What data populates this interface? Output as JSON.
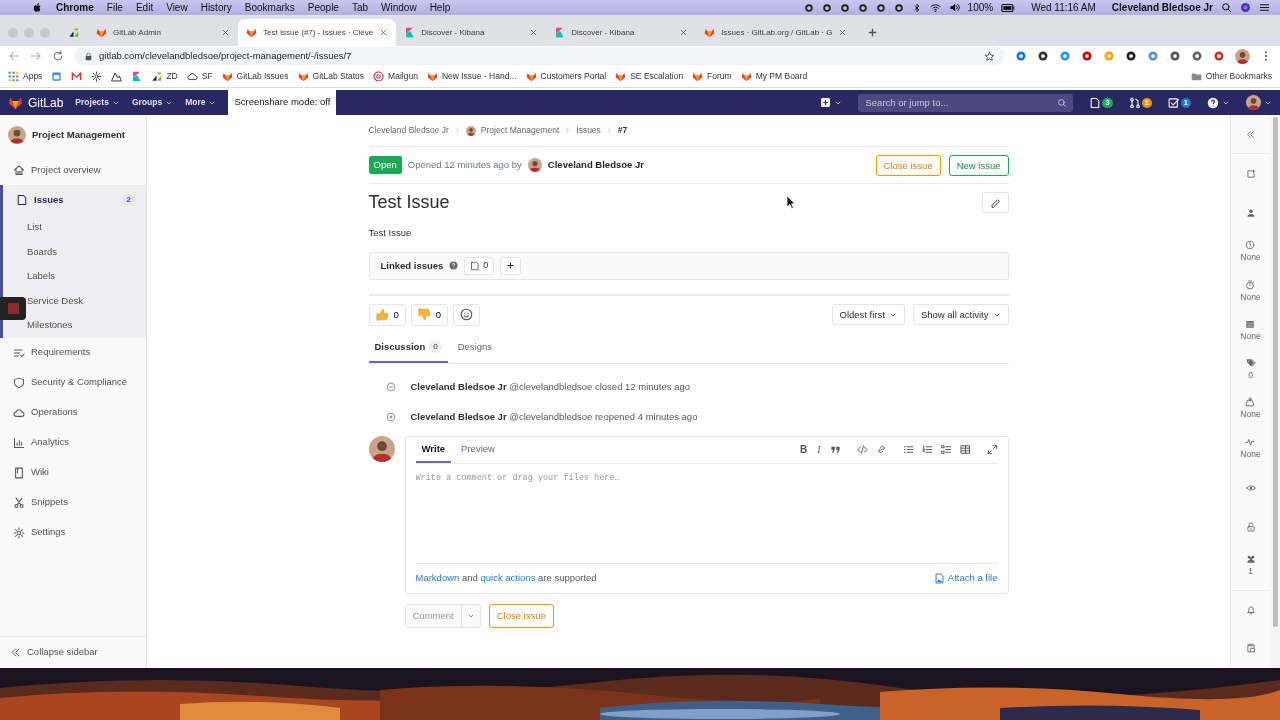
{
  "menu_bar": {
    "app": "Chrome",
    "menus": [
      "File",
      "Edit",
      "View",
      "History",
      "Bookmarks",
      "People",
      "Tab",
      "Window",
      "Help"
    ],
    "battery": "100%",
    "clock": "Wed 11:16 AM",
    "user": "Cleveland Bledsoe Jr"
  },
  "browser": {
    "tabs": [
      {
        "kind": "zendesk",
        "selected": false
      },
      {
        "kind": "gitlab",
        "title": "GitLab Admin",
        "selected": false
      },
      {
        "kind": "gitlab",
        "title": "Test Issue (#7) - Issues · Cleve",
        "selected": true
      },
      {
        "kind": "kibana",
        "title": "Discover - Kibana",
        "selected": false
      },
      {
        "kind": "kibana",
        "title": "Discover - Kibana",
        "selected": false
      },
      {
        "kind": "gitlab",
        "title": "Issues · GitLab.org / GitLab · G",
        "selected": false
      }
    ],
    "url": "gitlab.com/clevelandbledsoe/project-management/-/issues/7",
    "bookmarks": [
      {
        "kind": "apps",
        "label": "Apps"
      },
      {
        "kind": "calendar"
      },
      {
        "kind": "mail"
      },
      {
        "kind": "gear"
      },
      {
        "kind": "peaks"
      },
      {
        "kind": "kibana"
      },
      {
        "kind": "zendesk",
        "label": "ZD"
      },
      {
        "kind": "cloud",
        "label": "SF"
      },
      {
        "kind": "gitlab",
        "label": "GitLab Issues"
      },
      {
        "kind": "gitlab",
        "label": "GitLab Status"
      },
      {
        "kind": "target",
        "label": "Mailgun"
      },
      {
        "kind": "gitlab",
        "label": "New Issue - Hand..."
      },
      {
        "kind": "gitlab",
        "label": "Customers Portal"
      },
      {
        "kind": "gitlab",
        "label": "SE Escalation"
      },
      {
        "kind": "gitlab",
        "label": "Forum"
      },
      {
        "kind": "gitlab",
        "label": "My PM Board"
      }
    ],
    "other_bookmarks": "Other Bookmarks"
  },
  "navbar": {
    "brand": "GitLab",
    "menus": [
      "Projects",
      "Groups",
      "More"
    ],
    "screenshare": "Screenshare mode: off",
    "search_placeholder": "Search or jump to...",
    "counters": [
      {
        "kind": "issues",
        "count": "3",
        "color": "#1aaa55"
      },
      {
        "kind": "merge_requests",
        "count": "1",
        "color": "#fc9403"
      },
      {
        "kind": "todos",
        "count": "1",
        "color": "#1f78d1"
      }
    ]
  },
  "sidebar": {
    "project": "Project Management",
    "items": [
      {
        "kind": "home",
        "label": "Project overview",
        "selected": false
      },
      {
        "kind": "issues",
        "label": "Issues",
        "selected": true,
        "count": "2",
        "children": [
          {
            "label": "List"
          },
          {
            "label": "Boards"
          },
          {
            "label": "Labels"
          },
          {
            "label": "Service Desk"
          },
          {
            "label": "Milestones"
          }
        ]
      },
      {
        "kind": "requirements",
        "label": "Requirements",
        "selected": false
      },
      {
        "kind": "shield",
        "label": "Security & Compliance",
        "selected": false
      },
      {
        "kind": "cloud",
        "label": "Operations",
        "selected": false
      },
      {
        "kind": "chart",
        "label": "Analytics",
        "selected": false
      },
      {
        "kind": "book",
        "label": "Wiki",
        "selected": false
      },
      {
        "kind": "scissors",
        "label": "Snippets",
        "selected": false
      },
      {
        "kind": "gear",
        "label": "Settings",
        "selected": false
      }
    ],
    "collapse": "Collapse sidebar"
  },
  "issue": {
    "breadcrumbs": [
      "Cleveland Bledsoe Jr",
      "Project Management",
      "Issues",
      "#7"
    ],
    "status": "Open",
    "opened": "Opened 12 minutes ago by",
    "author": "Cleveland Bledsoe Jr",
    "actions": [
      {
        "kind": "close",
        "label": "Close issue"
      },
      {
        "kind": "new",
        "label": "New issue"
      }
    ],
    "title": "Test Issue",
    "description": "Test Issue",
    "linked_issues": {
      "label": "Linked issues",
      "count": "0"
    },
    "reactions": [
      {
        "kind": "thumbs_up",
        "count": "0"
      },
      {
        "kind": "thumbs_down",
        "count": "0"
      }
    ],
    "sort": "Oldest first",
    "filter": "Show all activity",
    "tabs": [
      {
        "label": "Discussion",
        "count": "0",
        "selected": true
      },
      {
        "label": "Designs",
        "selected": false
      }
    ],
    "events": [
      {
        "kind": "closed",
        "author": "Cleveland Bledsoe Jr",
        "handle": "@clevelandbledsoe",
        "action": "closed 12 minutes ago"
      },
      {
        "kind": "reopened",
        "author": "Cleveland Bledsoe Jr",
        "handle": "@clevelandbledsoe",
        "action": "reopened 4 minutes ago"
      }
    ],
    "editor": {
      "tabs": [
        {
          "label": "Write",
          "selected": true
        },
        {
          "label": "Preview",
          "selected": false
        }
      ],
      "toolbar": [
        {
          "kind": "bold",
          "glyph": "B"
        },
        {
          "kind": "italic",
          "glyph": "I"
        },
        {
          "kind": "quote"
        },
        {
          "kind": "code"
        },
        {
          "kind": "link"
        },
        {
          "kind": "bullet_list"
        },
        {
          "kind": "numbered_list"
        },
        {
          "kind": "task_list"
        },
        {
          "kind": "table"
        },
        {
          "kind": "fullscreen"
        }
      ],
      "placeholder": "Write a comment or drag your files here…",
      "help": [
        {
          "kind": "link",
          "text": "Markdown"
        },
        {
          "kind": "text",
          "text": "and"
        },
        {
          "kind": "link",
          "text": "quick actions"
        },
        {
          "kind": "text",
          "text": "are supported"
        }
      ],
      "attach": "Attach a file"
    },
    "submit": {
      "label": "Comment",
      "disabled": true
    },
    "close": "Close issue"
  },
  "right_sidebar": {
    "items": [
      {
        "kind": "todo"
      },
      {
        "kind": "assignee"
      },
      {
        "kind": "milestone",
        "value": "None"
      },
      {
        "kind": "time",
        "value": "None"
      },
      {
        "kind": "due",
        "value": "None"
      },
      {
        "kind": "labels",
        "value": "0"
      },
      {
        "kind": "weight",
        "value": "None"
      },
      {
        "kind": "health",
        "value": "None"
      },
      {
        "kind": "confidential"
      },
      {
        "kind": "lock"
      },
      {
        "kind": "participants",
        "value": "1"
      },
      {
        "kind": "notifications"
      },
      {
        "kind": "reference"
      }
    ]
  }
}
